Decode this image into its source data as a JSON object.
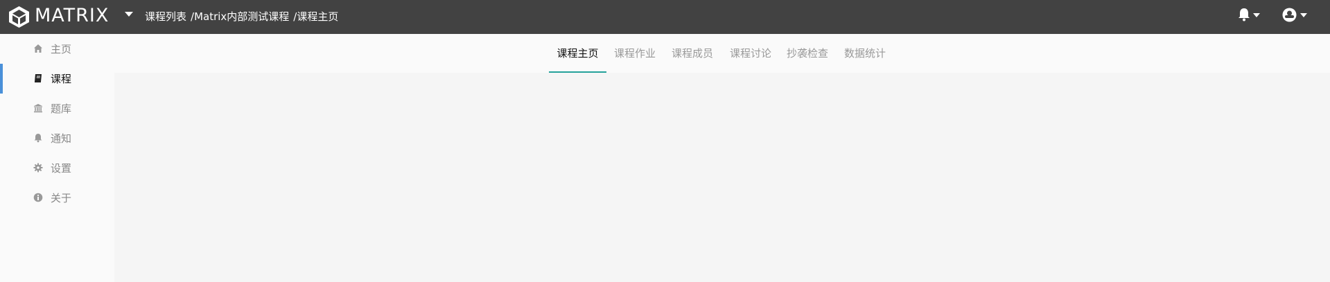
{
  "brand": {
    "name": "MATRIX",
    "logo_icon": "cube-logo-icon"
  },
  "header": {
    "breadcrumb": [
      "课程列表",
      "/Matrix内部测试课程",
      "/课程主页"
    ],
    "notification_icon": "bell-icon",
    "user_icon": "user-circle-icon"
  },
  "sidebar": {
    "items": [
      {
        "label": "主页",
        "icon": "home-icon",
        "active": false
      },
      {
        "label": "课程",
        "icon": "book-icon",
        "active": true
      },
      {
        "label": "题库",
        "icon": "bank-icon",
        "active": false
      },
      {
        "label": "通知",
        "icon": "bell-icon",
        "active": false
      },
      {
        "label": "设置",
        "icon": "gear-icon",
        "active": false
      },
      {
        "label": "关于",
        "icon": "info-icon",
        "active": false
      }
    ],
    "active_color": "#4a90d9"
  },
  "tabs": {
    "items": [
      "课程主页",
      "课程作业",
      "课程成员",
      "课程讨论",
      "抄袭检查",
      "数据统计"
    ],
    "active_index": 0,
    "underline_color": "#23a29a"
  },
  "colors": {
    "topbar": "#424242",
    "sidebar": "#fafafa",
    "content": "#f5f5f5"
  }
}
